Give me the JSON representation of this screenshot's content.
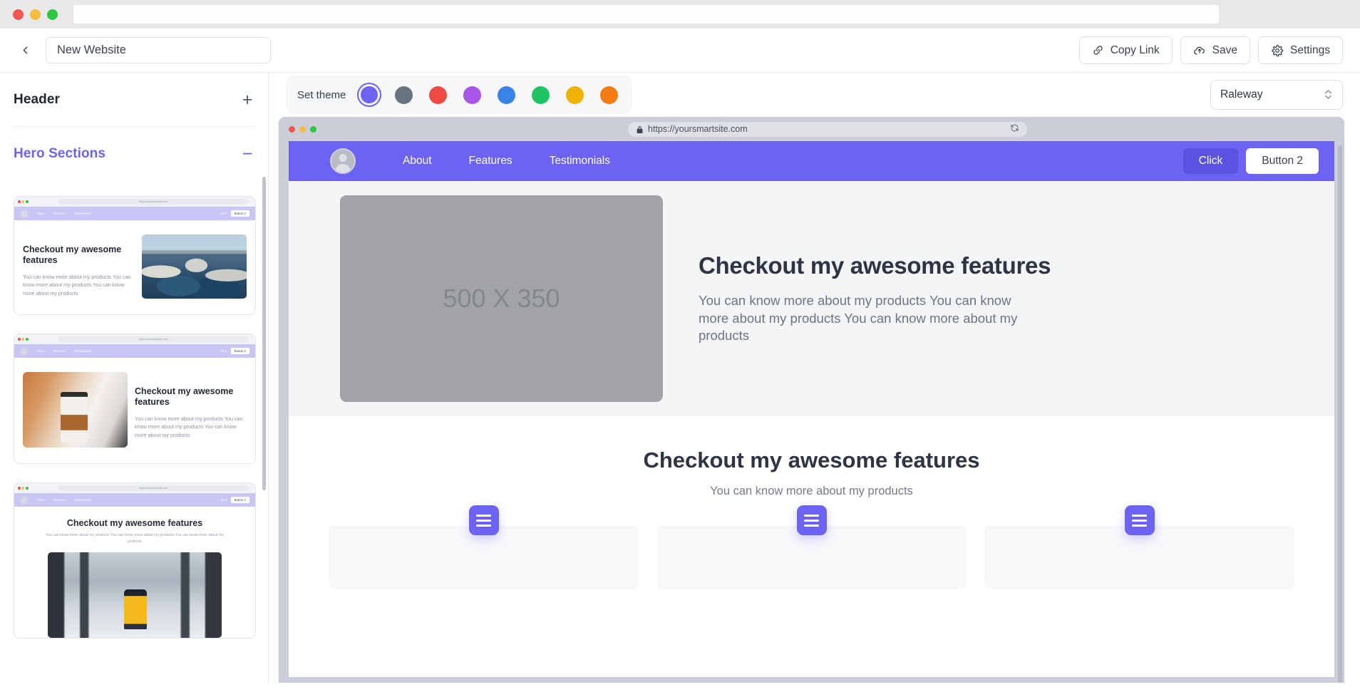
{
  "window": {
    "traffic_lights": [
      "red",
      "yellow",
      "green"
    ]
  },
  "toolbar": {
    "back_icon": "chevron-left-icon",
    "site_name_value": "New Website",
    "site_name_placeholder": "New Website",
    "buttons": [
      {
        "label": "Copy Link",
        "icon": "link-icon"
      },
      {
        "label": "Save",
        "icon": "cloud-upload-icon"
      },
      {
        "label": "Settings",
        "icon": "gear-icon"
      }
    ]
  },
  "sidebar": {
    "groups": [
      {
        "label": "Header",
        "state": "collapsed",
        "toggle": "plus-icon",
        "active": false
      },
      {
        "label": "Hero Sections",
        "state": "expanded",
        "toggle": "minus-icon",
        "active": true
      }
    ],
    "templates": [
      {
        "variant": "text-left-image-right",
        "heading": "Checkout my awesome features",
        "paragraph": "You can know more about my products You can know more about my products You can know more about my products",
        "image_alt": "harbour rocks photo",
        "nav": {
          "links": [
            "About",
            "Features",
            "Testimonials"
          ],
          "button_1": "Click",
          "button_2": "Button 2"
        },
        "url": "https://yoursmartsite.com"
      },
      {
        "variant": "image-left-text-right",
        "heading": "Checkout my awesome features",
        "paragraph": "You can know more about my products You can know more about my products You can know more about my products",
        "image_alt": "coffee cup on desk photo",
        "nav": {
          "links": [
            "About",
            "Features",
            "Testimonials"
          ],
          "button_1": "Click",
          "button_2": "Button 2"
        },
        "url": "https://yoursmartsite.com"
      },
      {
        "variant": "centered-stacked",
        "heading": "Checkout my awesome features",
        "paragraph": "You can know more about my products You can know more about my products You can know more about my products",
        "image_alt": "person in yellow coat in snowy forest photo",
        "nav": {
          "links": [
            "About",
            "Features",
            "Testimonials"
          ],
          "button_1": "Click",
          "button_2": "Button 2"
        },
        "url": "https://yoursmartsite.com"
      }
    ]
  },
  "theme_bar": {
    "label": "Set theme",
    "selected_index": 0,
    "swatches": [
      {
        "name": "indigo",
        "hex": "#6c63f4"
      },
      {
        "name": "slate",
        "hex": "#67737f"
      },
      {
        "name": "red",
        "hex": "#ef4a44"
      },
      {
        "name": "purple",
        "hex": "#a855e8"
      },
      {
        "name": "blue",
        "hex": "#3b82e8"
      },
      {
        "name": "green",
        "hex": "#1fc462"
      },
      {
        "name": "yellow",
        "hex": "#efb305"
      },
      {
        "name": "orange",
        "hex": "#f57c12"
      }
    ],
    "font_select": {
      "value": "Raleway",
      "caret": "chevron-updown-icon"
    }
  },
  "preview": {
    "browser": {
      "url": "https://yoursmartsite.com",
      "lock_icon": "lock-icon",
      "refresh_icon": "refresh-icon",
      "traffic_lights": [
        "red",
        "yellow",
        "green"
      ]
    },
    "site_nav": {
      "avatar": "user-avatar-placeholder",
      "links": [
        "About",
        "Features",
        "Testimonials"
      ],
      "button_1": "Click",
      "button_2": "Button 2"
    },
    "hero": {
      "image_placeholder": "500 X 350",
      "heading": "Checkout my awesome features",
      "paragraph": "You can know more about my products You can know more about my products You can know more about my products"
    },
    "features": {
      "heading": "Checkout my awesome features",
      "subheading": "You can know more about my products",
      "cards": [
        {
          "icon": "menu-icon"
        },
        {
          "icon": "menu-icon"
        },
        {
          "icon": "menu-icon"
        }
      ]
    }
  }
}
